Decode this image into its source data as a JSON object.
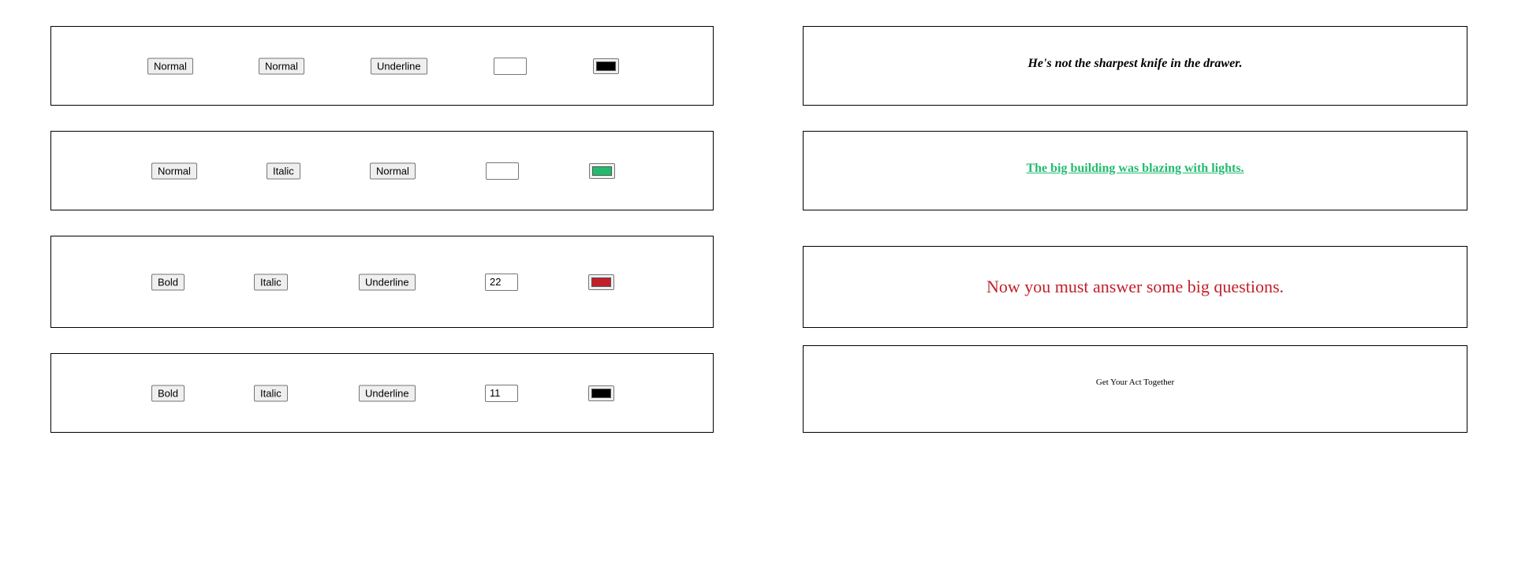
{
  "rows": [
    {
      "controls": {
        "weight_label": "Normal",
        "style_label": "Normal",
        "decoration_label": "Underline",
        "font_size_value": "",
        "color": "#000000"
      },
      "preview": {
        "text": "He's not the sharpest knife in the drawer.",
        "color": "#000000"
      }
    },
    {
      "controls": {
        "weight_label": "Normal",
        "style_label": "Italic",
        "decoration_label": "Normal",
        "font_size_value": "",
        "color": "#22bb6e"
      },
      "preview": {
        "text": "The big building was blazing with lights.",
        "color": "#22bb6e"
      }
    },
    {
      "controls": {
        "weight_label": "Bold",
        "style_label": "Italic",
        "decoration_label": "Underline",
        "font_size_value": "22",
        "color": "#c21f2a"
      },
      "preview": {
        "text": "Now you must answer some big questions.",
        "color": "#c21f2a"
      }
    },
    {
      "controls": {
        "weight_label": "Bold",
        "style_label": "Italic",
        "decoration_label": "Underline",
        "font_size_value": "11",
        "color": "#000000"
      },
      "preview": {
        "text": "Get Your Act Together",
        "color": "#000000"
      }
    }
  ]
}
